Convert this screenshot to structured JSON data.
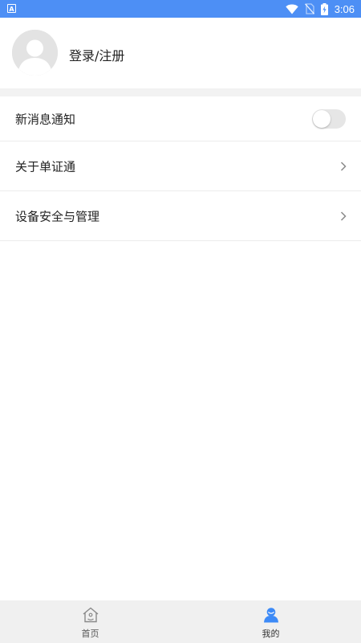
{
  "status_bar": {
    "time": "3:06",
    "app_icon_letter": "A",
    "icons": [
      "wifi-icon",
      "no-sim-icon",
      "battery-charging-icon"
    ]
  },
  "profile": {
    "avatar_icon": "user-avatar-icon",
    "login_label": "登录/注册"
  },
  "menu": {
    "items": [
      {
        "label": "新消息通知",
        "control": "toggle",
        "toggle_on": false
      },
      {
        "label": "关于单证通",
        "control": "chevron"
      },
      {
        "label": "设备安全与管理",
        "control": "chevron"
      }
    ]
  },
  "bottom_nav": {
    "items": [
      {
        "label": "首页",
        "icon": "home-icon",
        "active": false
      },
      {
        "label": "我的",
        "icon": "user-icon",
        "active": true
      }
    ]
  },
  "colors": {
    "status_bar": "#4d8ff5",
    "accent": "#3d8af7",
    "section_gap": "#f2f2f2",
    "nav_background": "#f0f0f0"
  }
}
